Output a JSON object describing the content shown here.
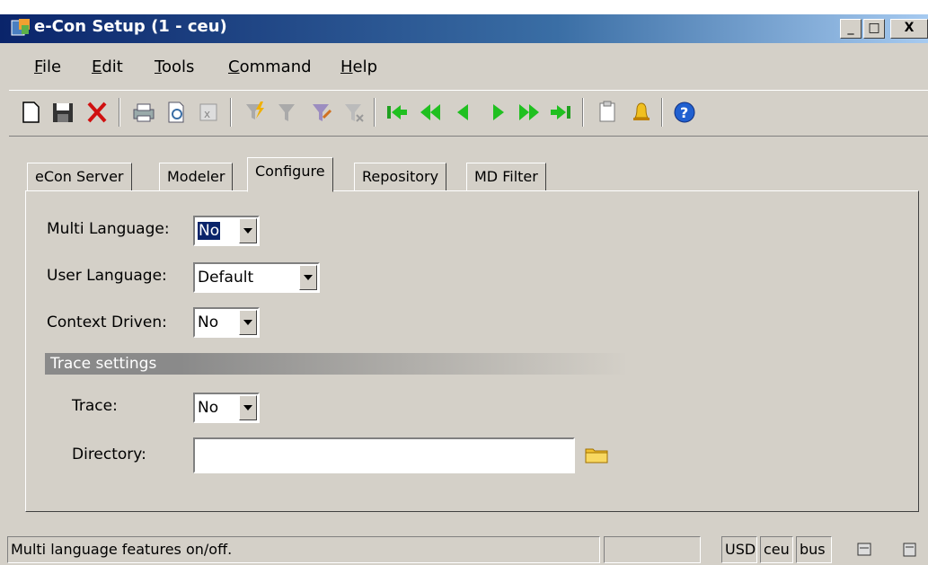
{
  "window": {
    "title": "e-Con Setup (1 - ceu)",
    "controls": {
      "minimize": "_",
      "maximize": "□",
      "close": "X"
    }
  },
  "menu": {
    "items": [
      {
        "label": "File",
        "accel": "F"
      },
      {
        "label": "Edit",
        "accel": "E"
      },
      {
        "label": "Tools",
        "accel": "T"
      },
      {
        "label": "Command",
        "accel": "C"
      },
      {
        "label": "Help",
        "accel": "H"
      }
    ]
  },
  "toolbar": {
    "icons": [
      "new-icon",
      "save-icon",
      "delete-icon",
      "print-icon",
      "print-preview-icon",
      "export-icon",
      "filter-lightning-icon",
      "filter-icon",
      "filter-edit-icon",
      "filter-clear-icon",
      "first-icon",
      "rewind-icon",
      "previous-icon",
      "next-icon",
      "fast-forward-icon",
      "last-icon",
      "paste-icon",
      "alert-bell-icon",
      "help-icon"
    ]
  },
  "tabs": [
    {
      "label": "eCon Server"
    },
    {
      "label": "Modeler"
    },
    {
      "label": "Configure",
      "active": true
    },
    {
      "label": "Repository"
    },
    {
      "label": "MD Filter"
    }
  ],
  "configure": {
    "multi_language": {
      "label": "Multi Language:",
      "value": "No"
    },
    "user_language": {
      "label": "User Language:",
      "value": "Default"
    },
    "context_driven": {
      "label": "Context Driven:",
      "value": "No"
    },
    "trace_settings": {
      "title": "Trace settings",
      "trace": {
        "label": "Trace:",
        "value": "No"
      },
      "directory": {
        "label": "Directory:",
        "value": ""
      }
    }
  },
  "statusbar": {
    "message": "Multi language features on/off.",
    "empty_pane": "",
    "currency": "USD",
    "company": "ceu",
    "segment": "bus"
  },
  "colors": {
    "titlebar_start": "#0a246a",
    "titlebar_end": "#a6caf0",
    "face": "#d4d0c8"
  }
}
